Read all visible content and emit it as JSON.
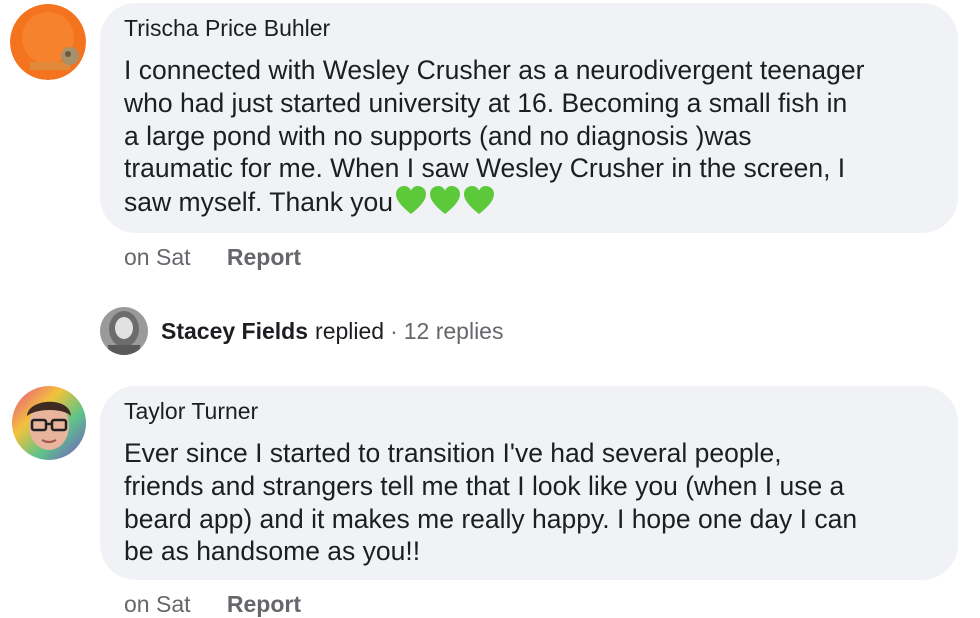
{
  "comments": [
    {
      "author": "Trischa Price Buhler",
      "text": "I connected with Wesley Crusher as a neurodivergent teenager\nwho had just started university at 16. Becoming a small fish in\na large pond with no supports (and no diagnosis )was\ntraumatic for me. When I saw Wesley Crusher in the screen, I\nsaw myself. Thank you",
      "emoji": [
        "green-heart",
        "green-heart",
        "green-heart"
      ],
      "time": "on Sat",
      "action": "Report"
    },
    {
      "author": "Taylor Turner",
      "text": "Ever since I started to transition I've had several people,\nfriends and strangers tell me that I look like you (when I use a\nbeard app) and it makes me really happy. I hope one day I can\nbe as handsome as you!!",
      "time": "on Sat",
      "action": "Report"
    }
  ],
  "reply_summary": {
    "name": "Stacey Fields",
    "verb": "replied",
    "separator": "·",
    "count": "12 replies"
  },
  "colors": {
    "bubble": "#f0f2f5",
    "meta_text": "#65676b",
    "heart": "#5cc93b"
  }
}
